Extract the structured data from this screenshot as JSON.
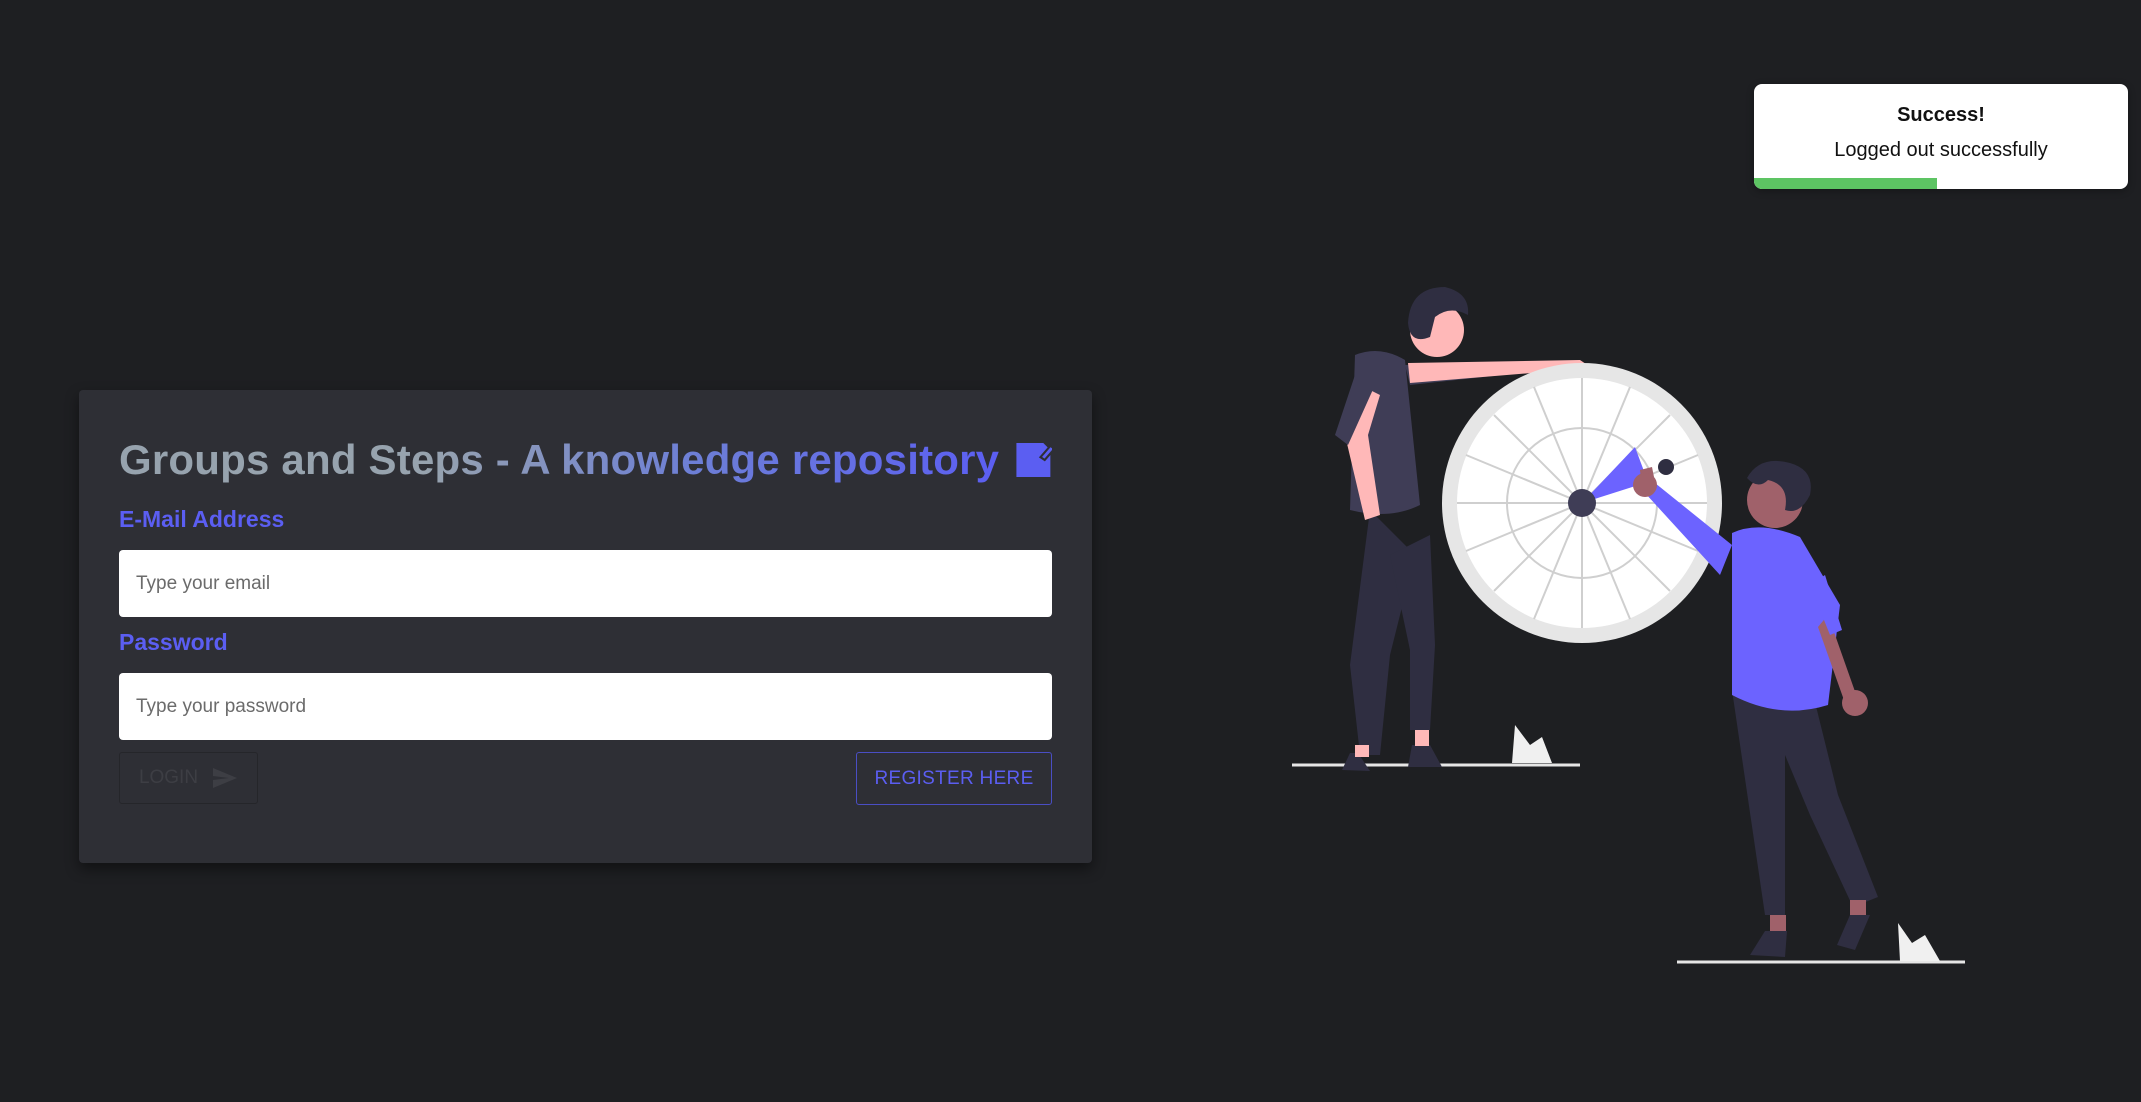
{
  "login": {
    "title": "Groups and Steps - A knowledge repository",
    "email_label": "E-Mail Address",
    "email_placeholder": "Type your email",
    "email_value": "",
    "password_label": "Password",
    "password_placeholder": "Type your password",
    "password_value": "",
    "login_button": "LOGIN",
    "register_button": "REGISTER HERE"
  },
  "toast": {
    "title": "Success!",
    "message": "Logged out successfully",
    "progress": 0.49
  },
  "colors": {
    "accent": "#5b5ef2",
    "background": "#1e1f22",
    "card": "#2e2f35",
    "success": "#5dc463"
  },
  "icons": {
    "title_icon": "note-icon",
    "login_icon": "send-icon"
  }
}
